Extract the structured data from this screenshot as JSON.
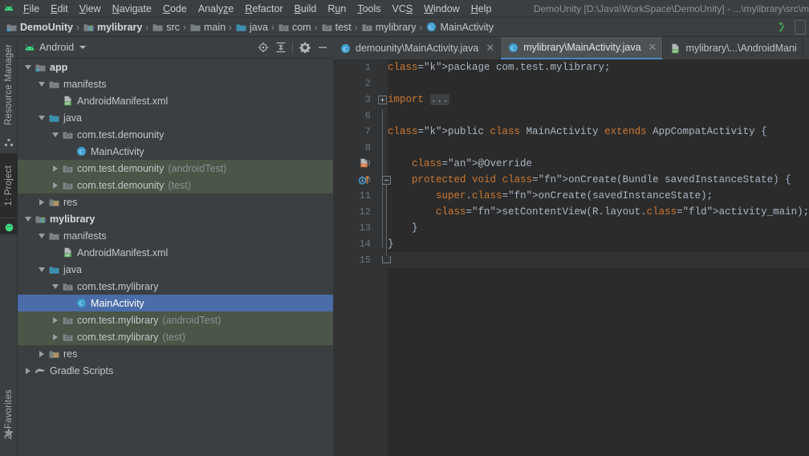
{
  "window": {
    "title": "DemoUnity [D:\\Java\\WorkSpace\\DemoUnity] - ...\\mylibrary\\src\\m",
    "logo_icon": "android-studio-logo-icon"
  },
  "menubar": {
    "items": [
      {
        "label": "File",
        "mnemonic": "F"
      },
      {
        "label": "Edit",
        "mnemonic": "E"
      },
      {
        "label": "View",
        "mnemonic": "V"
      },
      {
        "label": "Navigate",
        "mnemonic": "N"
      },
      {
        "label": "Code",
        "mnemonic": "C"
      },
      {
        "label": "Analyze",
        "mnemonic": "z"
      },
      {
        "label": "Refactor",
        "mnemonic": "R"
      },
      {
        "label": "Build",
        "mnemonic": "B"
      },
      {
        "label": "Run",
        "mnemonic": "u"
      },
      {
        "label": "Tools",
        "mnemonic": "T"
      },
      {
        "label": "VCS",
        "mnemonic": "S"
      },
      {
        "label": "Window",
        "mnemonic": "W"
      },
      {
        "label": "Help",
        "mnemonic": "H"
      }
    ]
  },
  "breadcrumb": {
    "items": [
      {
        "label": "DemoUnity",
        "icon": "module-icon",
        "bold": true
      },
      {
        "label": "mylibrary",
        "icon": "library-module-icon",
        "bold": true
      },
      {
        "label": "src",
        "icon": "folder-icon",
        "bold": false
      },
      {
        "label": "main",
        "icon": "folder-icon",
        "bold": false
      },
      {
        "label": "java",
        "icon": "source-folder-icon",
        "bold": false
      },
      {
        "label": "com",
        "icon": "package-icon",
        "bold": false
      },
      {
        "label": "test",
        "icon": "package-icon",
        "bold": false
      },
      {
        "label": "mylibrary",
        "icon": "package-icon",
        "bold": false
      },
      {
        "label": "MainActivity",
        "icon": "class-icon",
        "bold": false
      }
    ],
    "build_icon": "hammer-build-icon"
  },
  "toolstrip": {
    "buttons": [
      {
        "label": "Resource Manager",
        "icon": "resource-manager-icon",
        "active": false,
        "mnemonic": ""
      },
      {
        "label": "1: Project",
        "icon": "project-icon",
        "active": true,
        "mnemonic": "1"
      },
      {
        "label": "2: Favorites",
        "icon": "star-icon",
        "active": false,
        "mnemonic": "2"
      }
    ]
  },
  "project_panel": {
    "title": "Android",
    "title_icon": "android-head-icon",
    "toolbar": [
      {
        "name": "locate-icon",
        "label": "Select Opened File"
      },
      {
        "name": "collapse-all-icon",
        "label": "Collapse All"
      },
      {
        "name": "gear-icon",
        "label": "Settings"
      },
      {
        "name": "minimize-icon",
        "label": "Hide"
      }
    ],
    "tree": [
      {
        "depth": 0,
        "arrow": "open",
        "icon": "module-icon",
        "label": "app",
        "sub": "",
        "bold": true,
        "state": "normal"
      },
      {
        "depth": 1,
        "arrow": "open",
        "icon": "folder-icon",
        "label": "manifests",
        "sub": "",
        "bold": false,
        "state": "normal"
      },
      {
        "depth": 2,
        "arrow": "none",
        "icon": "manifest-file-icon",
        "label": "AndroidManifest.xml",
        "sub": "",
        "bold": false,
        "state": "normal"
      },
      {
        "depth": 1,
        "arrow": "open",
        "icon": "source-folder-icon",
        "label": "java",
        "sub": "",
        "bold": false,
        "state": "normal"
      },
      {
        "depth": 2,
        "arrow": "open",
        "icon": "package-icon",
        "label": "com.test.demounity",
        "sub": "",
        "bold": false,
        "state": "normal"
      },
      {
        "depth": 3,
        "arrow": "none",
        "icon": "class-icon",
        "label": "MainActivity",
        "sub": "",
        "bold": false,
        "state": "normal"
      },
      {
        "depth": 2,
        "arrow": "closed",
        "icon": "package-icon",
        "label": "com.test.demounity",
        "sub": "(androidTest)",
        "bold": false,
        "state": "scope"
      },
      {
        "depth": 2,
        "arrow": "closed",
        "icon": "package-icon",
        "label": "com.test.demounity",
        "sub": "(test)",
        "bold": false,
        "state": "scope"
      },
      {
        "depth": 1,
        "arrow": "closed",
        "icon": "res-folder-icon",
        "label": "res",
        "sub": "",
        "bold": false,
        "state": "normal"
      },
      {
        "depth": 0,
        "arrow": "open",
        "icon": "library-module-icon",
        "label": "mylibrary",
        "sub": "",
        "bold": true,
        "state": "normal"
      },
      {
        "depth": 1,
        "arrow": "open",
        "icon": "folder-icon",
        "label": "manifests",
        "sub": "",
        "bold": false,
        "state": "normal"
      },
      {
        "depth": 2,
        "arrow": "none",
        "icon": "manifest-file-icon",
        "label": "AndroidManifest.xml",
        "sub": "",
        "bold": false,
        "state": "normal"
      },
      {
        "depth": 1,
        "arrow": "open",
        "icon": "source-folder-icon",
        "label": "java",
        "sub": "",
        "bold": false,
        "state": "normal"
      },
      {
        "depth": 2,
        "arrow": "open",
        "icon": "package-icon",
        "label": "com.test.mylibrary",
        "sub": "",
        "bold": false,
        "state": "normal"
      },
      {
        "depth": 3,
        "arrow": "none",
        "icon": "class-icon",
        "label": "MainActivity",
        "sub": "",
        "bold": false,
        "state": "selected"
      },
      {
        "depth": 2,
        "arrow": "closed",
        "icon": "package-icon",
        "label": "com.test.mylibrary",
        "sub": "(androidTest)",
        "bold": false,
        "state": "scope"
      },
      {
        "depth": 2,
        "arrow": "closed",
        "icon": "package-icon",
        "label": "com.test.mylibrary",
        "sub": "(test)",
        "bold": false,
        "state": "scope"
      },
      {
        "depth": 1,
        "arrow": "closed",
        "icon": "res-folder-icon",
        "label": "res",
        "sub": "",
        "bold": false,
        "state": "normal"
      },
      {
        "depth": 0,
        "arrow": "closed",
        "icon": "gradle-icon",
        "label": "Gradle Scripts",
        "sub": "",
        "bold": false,
        "state": "normal"
      }
    ]
  },
  "editor": {
    "tabs": [
      {
        "label": "demounity\\MainActivity.java",
        "icon": "class-icon",
        "active": false,
        "closable": true
      },
      {
        "label": "mylibrary\\MainActivity.java",
        "icon": "class-icon",
        "active": true,
        "closable": true
      },
      {
        "label": "mylibrary\\...\\AndroidMani",
        "icon": "manifest-file-icon",
        "active": false,
        "closable": false
      }
    ],
    "line_numbers": [
      "1",
      "2",
      "3",
      "6",
      "7",
      "8",
      "9",
      "10",
      "11",
      "12",
      "13",
      "14",
      "15"
    ],
    "caret_line_index": 12,
    "gutter_icons": [
      {
        "line_index": 6,
        "name": "layout-file-gutter-icon"
      },
      {
        "line_index": 7,
        "name": "overridden-method-gutter-icon"
      }
    ],
    "code_lines": [
      "package com.test.mylibrary;",
      "",
      "import ...",
      "",
      "public class MainActivity extends AppCompatActivity {",
      "",
      "    @Override",
      "    protected void onCreate(Bundle savedInstanceState) {",
      "        super.onCreate(savedInstanceState);",
      "        setContentView(R.layout.activity_main);",
      "    }",
      "}",
      ""
    ]
  },
  "colors": {
    "chrome_bg": "#3c3f41",
    "editor_bg": "#2b2b2b",
    "gutter_bg": "#313335",
    "selection_blue": "#4a6ca8",
    "scope_green": "#4b5548",
    "accent_tab_underline": "#4a88c7",
    "keyword_orange": "#cc7832",
    "string_green": "#6a8759",
    "annotation_yellow": "#bbb529",
    "method_yellow": "#ffc66d",
    "static_field_purple": "#9876aa",
    "default_text": "#a9b7c6"
  }
}
